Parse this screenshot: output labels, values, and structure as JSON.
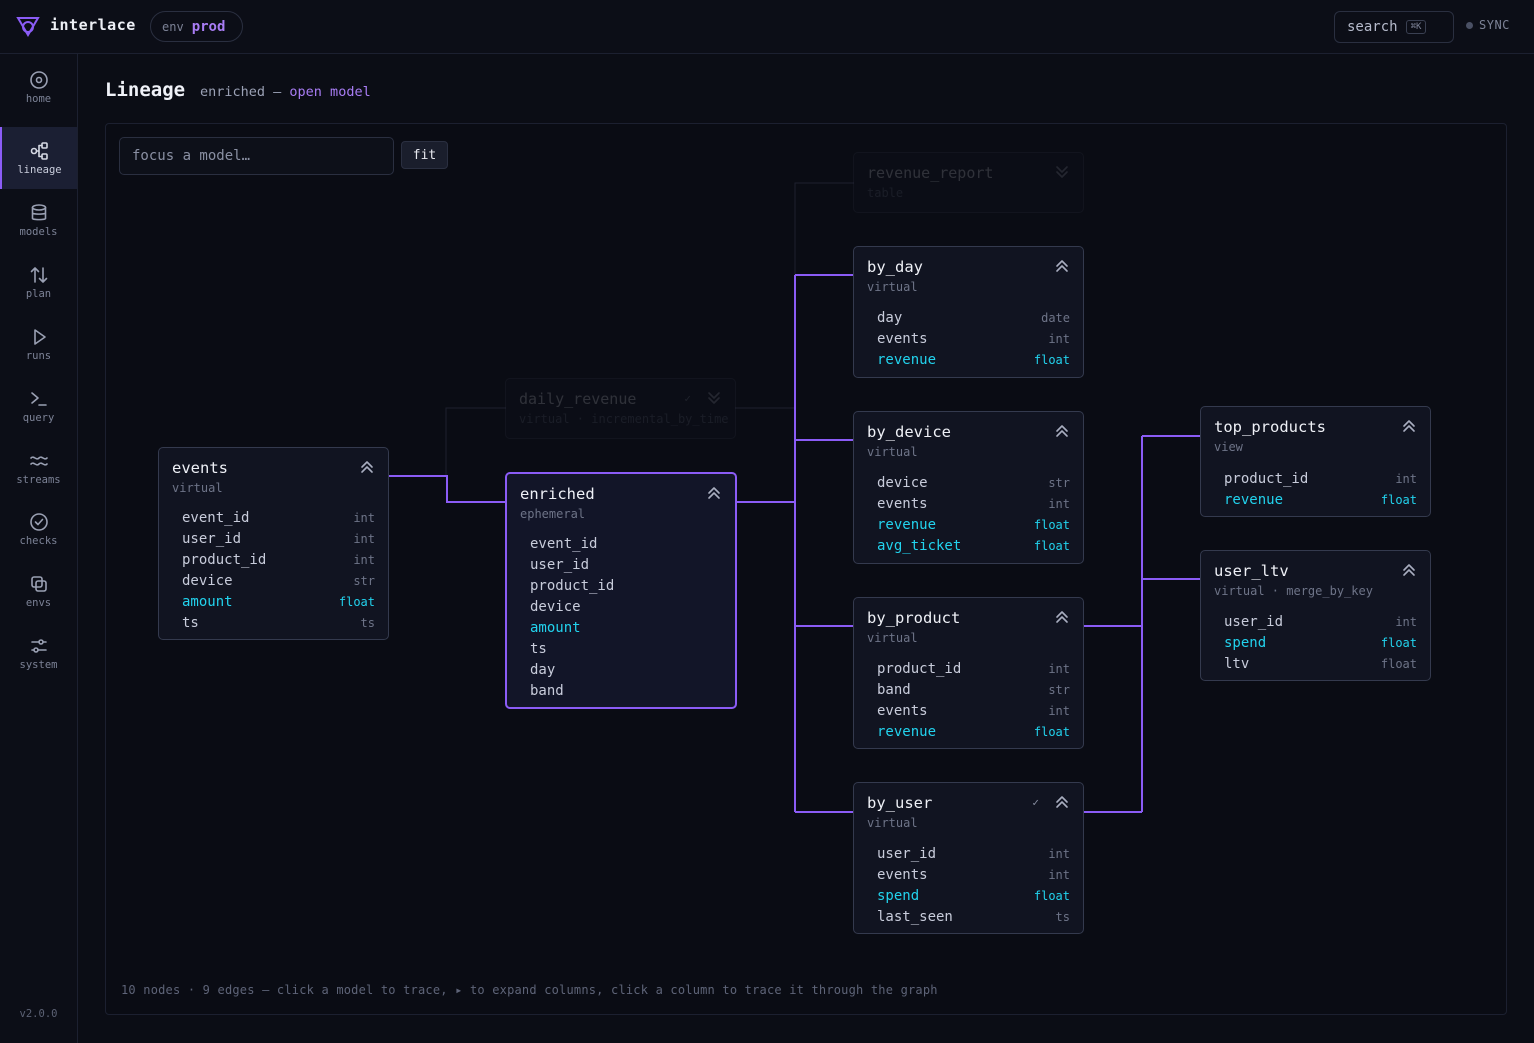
{
  "app": {
    "name": "interlace",
    "env_label": "env",
    "env_value": "prod"
  },
  "topbar": {
    "search_label": "search",
    "search_kbd": "⌘K",
    "sync_label": "SYNC"
  },
  "sidebar": {
    "items": [
      {
        "label": "home",
        "icon": "home-icon"
      },
      {
        "label": "lineage",
        "icon": "lineage-icon",
        "active": true
      },
      {
        "label": "models",
        "icon": "database-icon"
      },
      {
        "label": "plan",
        "icon": "arrows-icon"
      },
      {
        "label": "runs",
        "icon": "play-icon"
      },
      {
        "label": "query",
        "icon": "terminal-icon"
      },
      {
        "label": "streams",
        "icon": "waves-icon"
      },
      {
        "label": "checks",
        "icon": "check-circle-icon"
      },
      {
        "label": "envs",
        "icon": "copy-icon"
      },
      {
        "label": "system",
        "icon": "sliders-icon"
      }
    ],
    "version": "v2.0.0"
  },
  "header": {
    "title": "Lineage",
    "subtitle": "enriched —",
    "open_link": "open model"
  },
  "toolbar": {
    "focus_placeholder": "focus a model…",
    "fit_label": "fit"
  },
  "footer_hint": "10 nodes · 9 edges — click a model to trace, ▸ to expand columns, click a column to trace it through the graph",
  "nodes": {
    "revenue_report": {
      "title": "revenue_report",
      "kind": "table"
    },
    "daily_revenue": {
      "title": "daily_revenue",
      "kind": "virtual · incremental_by_time",
      "check": "✓"
    },
    "events": {
      "title": "events",
      "kind": "virtual",
      "columns": [
        {
          "name": "event_id",
          "type": "int"
        },
        {
          "name": "user_id",
          "type": "int"
        },
        {
          "name": "product_id",
          "type": "int"
        },
        {
          "name": "device",
          "type": "str"
        },
        {
          "name": "amount",
          "type": "float",
          "hl": true
        },
        {
          "name": "ts",
          "type": "ts"
        }
      ]
    },
    "enriched": {
      "title": "enriched",
      "kind": "ephemeral",
      "columns": [
        {
          "name": "event_id",
          "type": ""
        },
        {
          "name": "user_id",
          "type": ""
        },
        {
          "name": "product_id",
          "type": ""
        },
        {
          "name": "device",
          "type": ""
        },
        {
          "name": "amount",
          "type": "",
          "hl": true
        },
        {
          "name": "ts",
          "type": ""
        },
        {
          "name": "day",
          "type": ""
        },
        {
          "name": "band",
          "type": ""
        }
      ]
    },
    "by_day": {
      "title": "by_day",
      "kind": "virtual",
      "columns": [
        {
          "name": "day",
          "type": "date"
        },
        {
          "name": "events",
          "type": "int"
        },
        {
          "name": "revenue",
          "type": "float",
          "hl": true
        }
      ]
    },
    "by_device": {
      "title": "by_device",
      "kind": "virtual",
      "columns": [
        {
          "name": "device",
          "type": "str"
        },
        {
          "name": "events",
          "type": "int"
        },
        {
          "name": "revenue",
          "type": "float",
          "hl": true
        },
        {
          "name": "avg_ticket",
          "type": "float",
          "hl": true
        }
      ]
    },
    "by_product": {
      "title": "by_product",
      "kind": "virtual",
      "columns": [
        {
          "name": "product_id",
          "type": "int"
        },
        {
          "name": "band",
          "type": "str"
        },
        {
          "name": "events",
          "type": "int"
        },
        {
          "name": "revenue",
          "type": "float",
          "hl": true
        }
      ]
    },
    "by_user": {
      "title": "by_user",
      "kind": "virtual",
      "check": "✓",
      "columns": [
        {
          "name": "user_id",
          "type": "int"
        },
        {
          "name": "events",
          "type": "int"
        },
        {
          "name": "spend",
          "type": "float",
          "hl": true
        },
        {
          "name": "last_seen",
          "type": "ts"
        }
      ]
    },
    "top_products": {
      "title": "top_products",
      "kind": "view",
      "columns": [
        {
          "name": "product_id",
          "type": "int"
        },
        {
          "name": "revenue",
          "type": "float",
          "hl": true
        }
      ]
    },
    "user_ltv": {
      "title": "user_ltv",
      "kind": "virtual · merge_by_key",
      "columns": [
        {
          "name": "user_id",
          "type": "int"
        },
        {
          "name": "spend",
          "type": "float",
          "hl": true
        },
        {
          "name": "ltv",
          "type": "float"
        }
      ]
    }
  },
  "colors": {
    "accent": "#8b5cf6",
    "highlight": "#22d3ee",
    "background": "#0b0d15"
  }
}
